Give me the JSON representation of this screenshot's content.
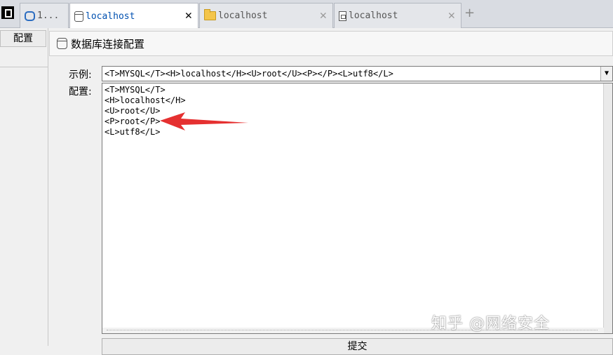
{
  "tabs": [
    {
      "label": "1...",
      "icon": "hexagon-icon"
    },
    {
      "label": "localhost",
      "icon": "database-icon",
      "active": true
    },
    {
      "label": "localhost",
      "icon": "folder-icon"
    },
    {
      "label": "localhost",
      "icon": "file-icon"
    }
  ],
  "left": {
    "config_label": "配置"
  },
  "panel": {
    "title": "数据库连接配置",
    "example_label": "示例:",
    "example_value": "<T>MYSQL</T><H>localhost</H><U>root</U><P></P><L>utf8</L>",
    "config_label": "配置:",
    "config_value": "<T>MYSQL</T>\n<H>localhost</H>\n<U>root</U>\n<P>root</P>\n<L>utf8</L>",
    "save_label": "提交"
  },
  "watermark": "知乎 @网络安全",
  "colors": {
    "accent": "#0050b0",
    "arrow": "#e53030"
  }
}
